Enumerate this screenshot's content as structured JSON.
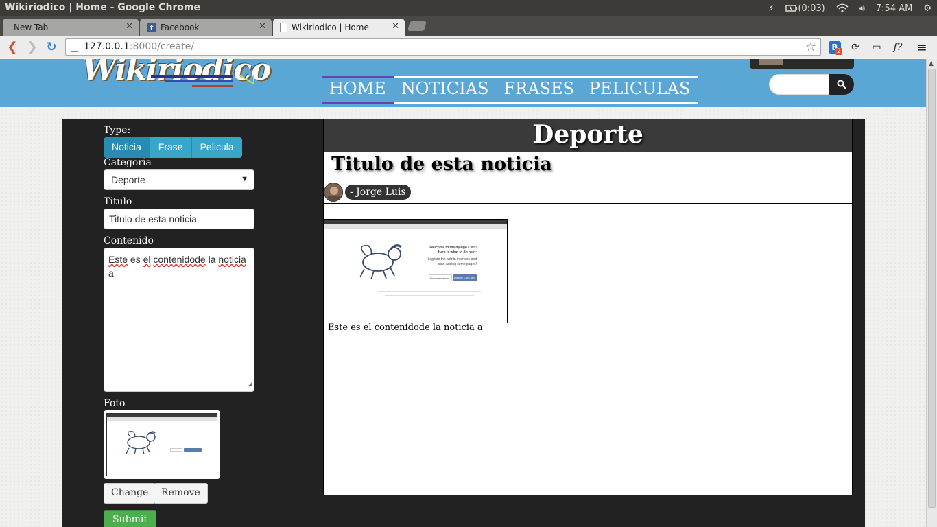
{
  "os": {
    "window_title": "Wikiriodico | Home - Google Chrome",
    "battery": "(0:03)",
    "clock": "7:54 AM"
  },
  "browser": {
    "tabs": [
      {
        "label": "New Tab"
      },
      {
        "label": "Facebook"
      },
      {
        "label": "Wikiriodico | Home"
      }
    ],
    "url_host": "127.0.0.1",
    "url_path": ":8000/create/",
    "ext_badge": "2"
  },
  "site": {
    "logo_text": "Wikiriodico",
    "nav": [
      "HOME",
      "NOTICIAS",
      "FRASES",
      "PELICULAS"
    ]
  },
  "form": {
    "type_label": "Type:",
    "type_options": [
      "Noticia",
      "Frase",
      "Pelicula"
    ],
    "categoria_label": "Categoria",
    "categoria_value": "Deporte",
    "titulo_label": "Titulo",
    "titulo_value": "Titulo de esta noticia",
    "contenido_label": "Contenido",
    "contenido_words": [
      "Este",
      "es",
      "el",
      "contenidode",
      "la",
      "noticia",
      "a"
    ],
    "foto_label": "Foto",
    "change_label": "Change",
    "remove_label": "Remove",
    "submit_label": "Submit"
  },
  "preview": {
    "category": "Deporte",
    "title": "Titulo de esta noticia",
    "author": "- Jorge Luis",
    "body": "Este es el contenidode la noticia a"
  },
  "mini_screenshot": {
    "welcome": "Welcome to the django CMS!",
    "subtitle": "Here is what to do next:",
    "line1": "Log into the admin interface and",
    "line2": "start adding some pages!",
    "doc_button": "Documentation",
    "cms_button": "Django CMS.org"
  }
}
